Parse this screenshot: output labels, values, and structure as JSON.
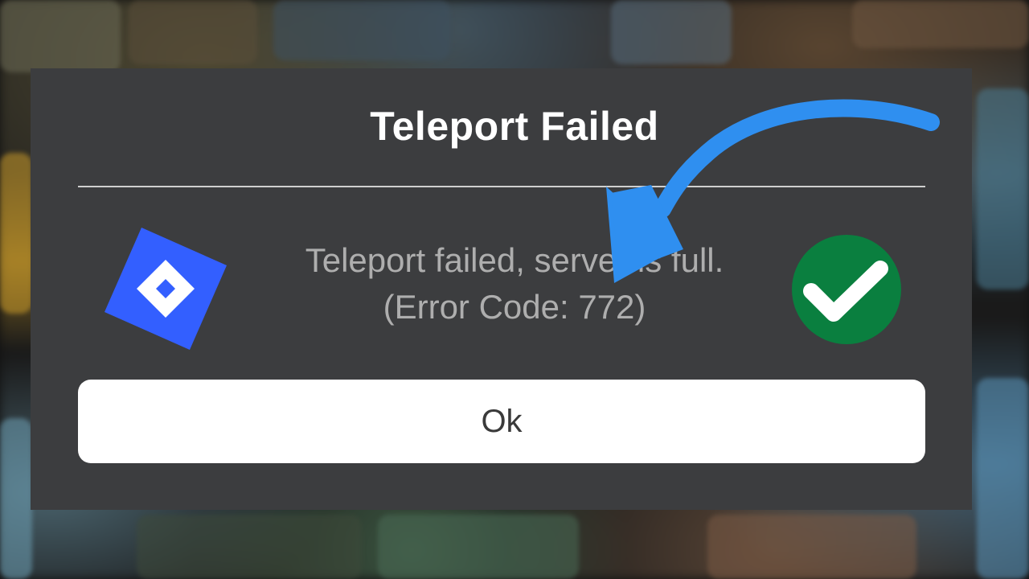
{
  "dialog": {
    "title": "Teleport Failed",
    "message_line1": "Teleport failed, server is full.",
    "message_line2": "(Error Code: 772)",
    "ok_label": "Ok"
  },
  "icons": {
    "logo": "roblox-logo-icon",
    "check": "checkmark-icon",
    "arrow": "curved-arrow-icon"
  },
  "colors": {
    "dialog_bg": "#3c3d3f",
    "logo_blue": "#335fff",
    "check_green": "#0a7f3f",
    "arrow_blue": "#2f8ff0"
  }
}
